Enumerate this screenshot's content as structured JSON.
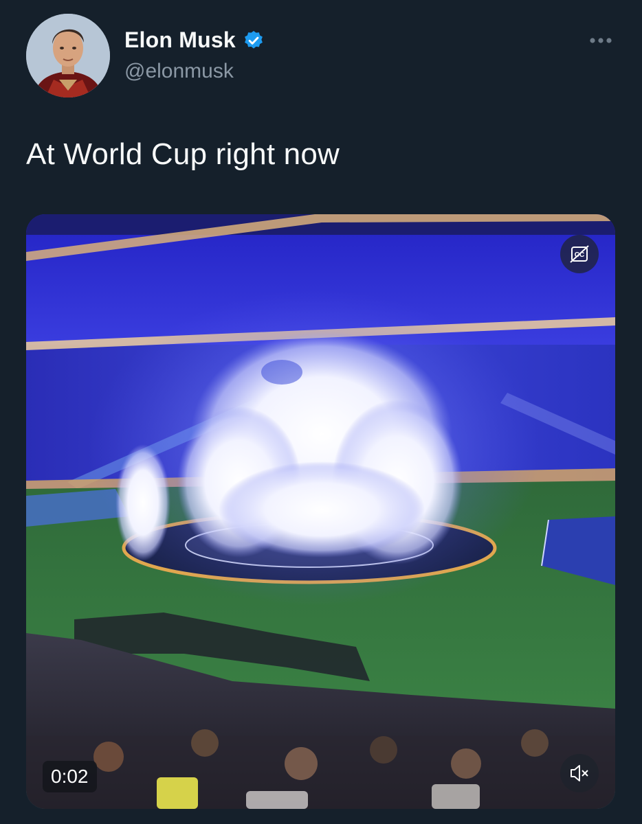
{
  "author": {
    "name": "Elon Musk",
    "handle": "@elonmusk",
    "verified": true,
    "avatar_icon": "profile-photo"
  },
  "tweet": {
    "text": "At World Cup right now"
  },
  "media": {
    "type": "video",
    "timestamp": "0:02",
    "captions_icon": "closed-captions-off-icon",
    "sound_icon": "speaker-muted-icon",
    "more_icon": "more-options-icon"
  },
  "colors": {
    "background": "#15202b",
    "verified": "#1d9bf0",
    "secondary_text": "#8b98a5",
    "primary_text": "#f7f9f9"
  }
}
